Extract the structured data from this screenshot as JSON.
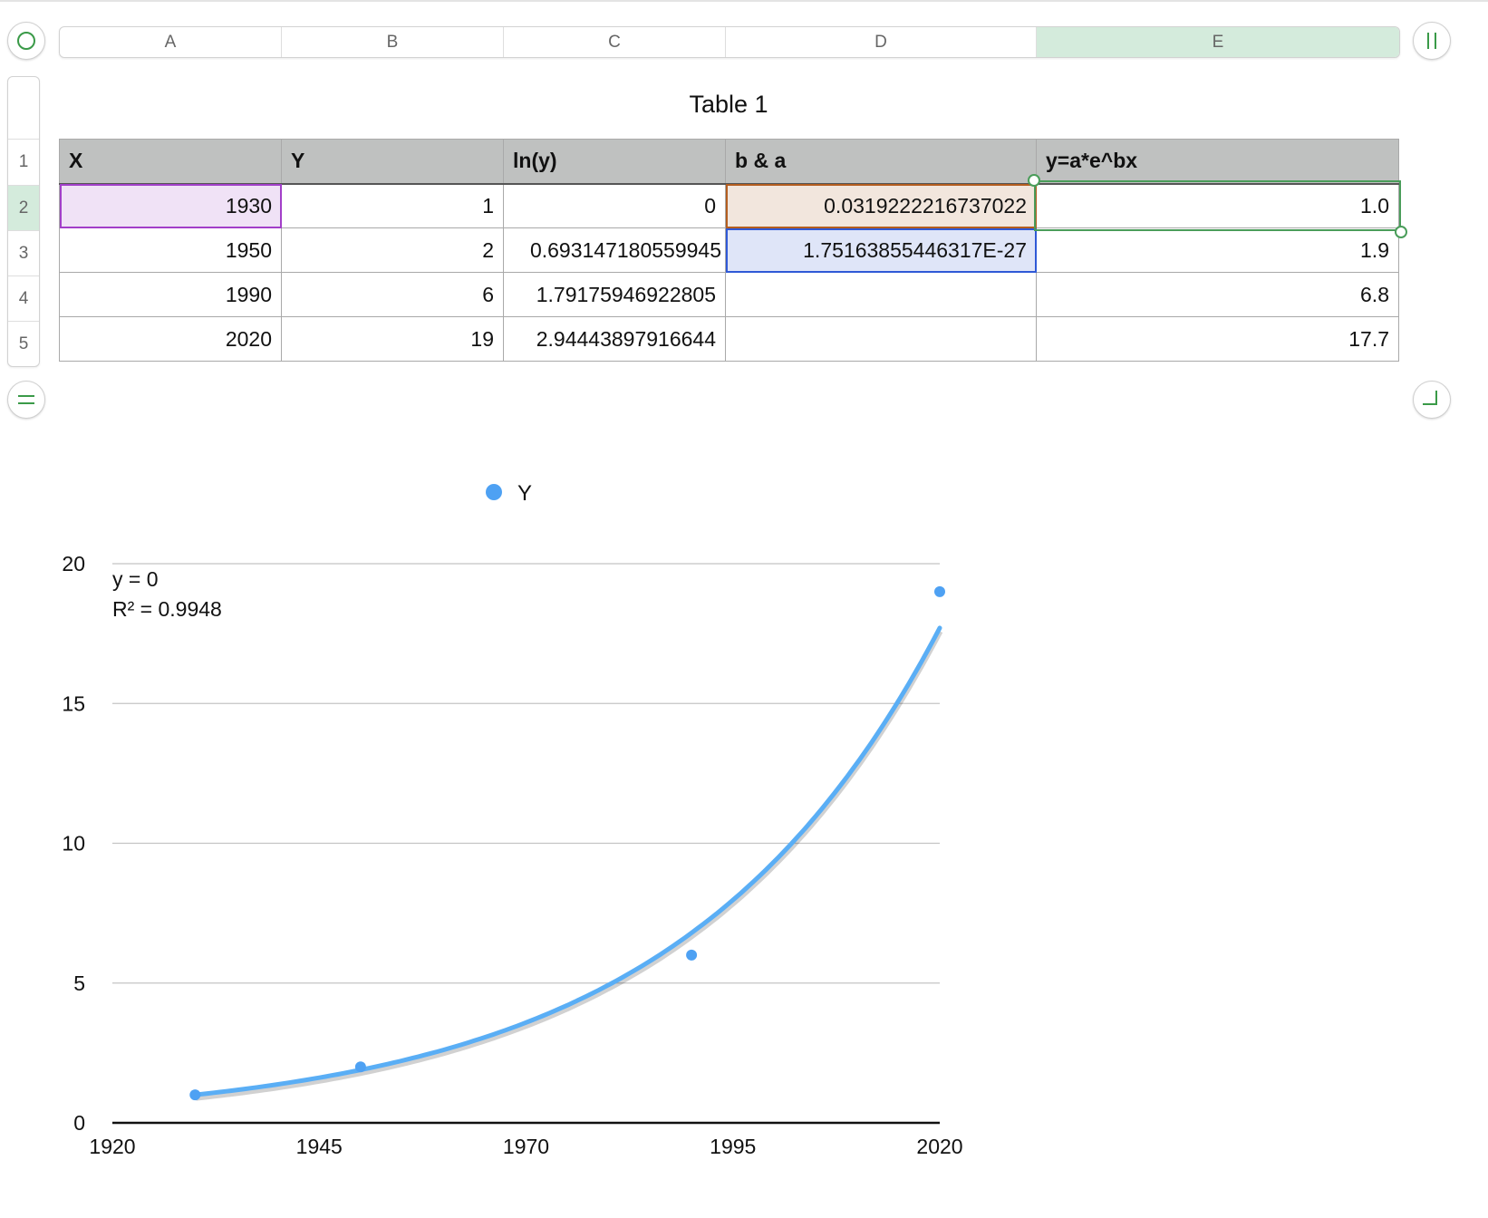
{
  "table": {
    "title": "Table 1",
    "column_letters": [
      "A",
      "B",
      "C",
      "D",
      "E"
    ],
    "selected_column": "E",
    "row_numbers": [
      "1",
      "2",
      "3",
      "4",
      "5"
    ],
    "selected_row": "2",
    "header": [
      "X",
      "Y",
      "ln(y)",
      "b & a",
      "y=a*e^bx"
    ],
    "rows": [
      [
        "1930",
        "1",
        "0",
        "0.0319222216737022",
        "1.0"
      ],
      [
        "1950",
        "2",
        "0.693147180559945",
        "1.75163855446317E-27",
        "1.9"
      ],
      [
        "1990",
        "6",
        "1.79175946922805",
        "",
        "6.8"
      ],
      [
        "2020",
        "19",
        "2.94443897916644",
        "",
        "17.7"
      ]
    ]
  },
  "controls": {
    "top_left": "circle-select-icon",
    "top_right": "column-pause-icon",
    "bottom_left": "row-equals-icon",
    "bottom_right": "corner-resize-icon"
  },
  "colors": {
    "accent_green": "#3a9a48",
    "series": "#4ea1f3"
  },
  "chart_data": {
    "type": "scatter",
    "title": "",
    "legend": [
      "Y"
    ],
    "legend_placement": "top-center",
    "xlabel": "",
    "ylabel": "",
    "xlim": [
      1920,
      2020
    ],
    "ylim": [
      0,
      20
    ],
    "xticks": [
      "1920",
      "1945",
      "1970",
      "1995",
      "2020"
    ],
    "xtick_values": [
      1920,
      1945,
      1970,
      1995,
      2020
    ],
    "yticks": [
      "0",
      "5",
      "10",
      "15",
      "20"
    ],
    "ytick_values": [
      0,
      5,
      10,
      15,
      20
    ],
    "grid": true,
    "series": [
      {
        "name": "Y",
        "x": [
          1930,
          1950,
          1990,
          2020
        ],
        "y": [
          1,
          2,
          6,
          19
        ]
      }
    ],
    "trendline": {
      "type": "exponential",
      "a": 1.75163855446317e-27,
      "b": 0.0319222216737022,
      "x_range": [
        1930,
        2020
      ],
      "equation": "y = 0",
      "r_squared": "R² = 0.9948"
    }
  }
}
